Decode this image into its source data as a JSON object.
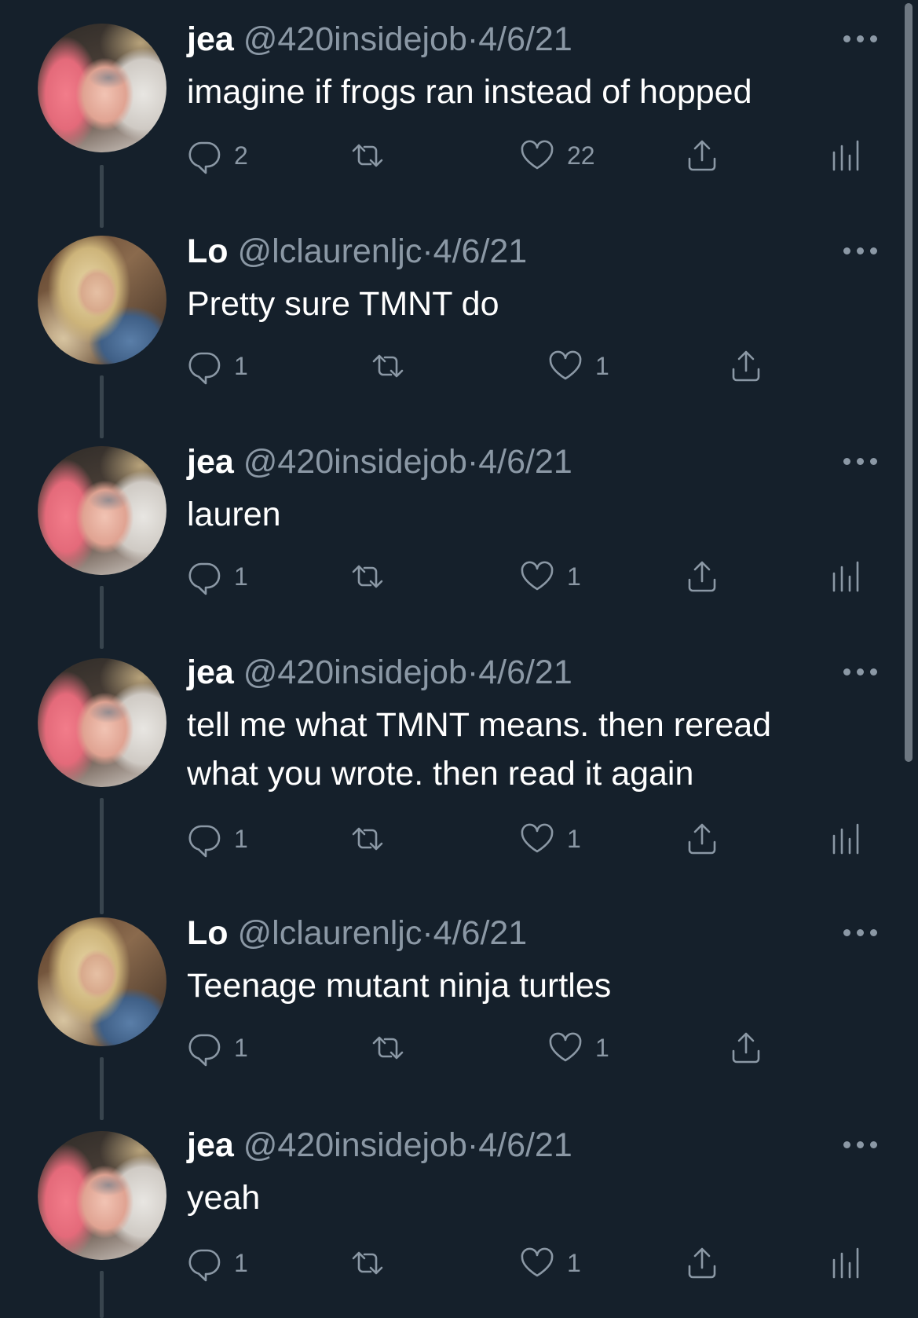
{
  "thread": {
    "tweets": [
      {
        "name": "jea",
        "handle": "@420insidejob",
        "separator": "·",
        "date": "4/6/21",
        "text": "imagine if frogs ran instead of hopped",
        "replies": "2",
        "retweets": "",
        "likes": "22",
        "avatar": "jea-avatar-photo",
        "has_analytics": true
      },
      {
        "name": "Lo",
        "handle": "@lclaurenljc",
        "separator": "·",
        "date": "4/6/21",
        "text": "Pretty sure TMNT do",
        "replies": "1",
        "retweets": "",
        "likes": "1",
        "avatar": "lo-avatar-photo",
        "has_analytics": false
      },
      {
        "name": "jea",
        "handle": "@420insidejob",
        "separator": "·",
        "date": "4/6/21",
        "text": "lauren",
        "replies": "1",
        "retweets": "",
        "likes": "1",
        "avatar": "jea-avatar-photo",
        "has_analytics": true
      },
      {
        "name": "jea",
        "handle": "@420insidejob",
        "separator": "·",
        "date": "4/6/21",
        "text_lines": [
          "tell me what TMNT means. then reread",
          "what you wrote. then read it again"
        ],
        "replies": "1",
        "retweets": "",
        "likes": "1",
        "avatar": "jea-avatar-photo",
        "has_analytics": true
      },
      {
        "name": "Lo",
        "handle": "@lclaurenljc",
        "separator": "·",
        "date": "4/6/21",
        "text": "Teenage mutant ninja turtles",
        "replies": "1",
        "retweets": "",
        "likes": "1",
        "avatar": "lo-avatar-photo",
        "has_analytics": false
      },
      {
        "name": "jea",
        "handle": "@420insidejob",
        "separator": "·",
        "date": "4/6/21",
        "text": "yeah",
        "replies": "1",
        "retweets": "",
        "likes": "1",
        "avatar": "jea-avatar-photo",
        "has_analytics": true
      }
    ]
  },
  "icons": {
    "reply": "reply-icon",
    "retweet": "retweet-icon",
    "like": "heart-icon",
    "share": "share-icon",
    "analytics": "analytics-icon",
    "more": "more-icon"
  },
  "colors": {
    "background": "#15202b",
    "primary_text": "#ffffff",
    "secondary_text": "#8b98a5",
    "thread_line": "#38444d"
  }
}
